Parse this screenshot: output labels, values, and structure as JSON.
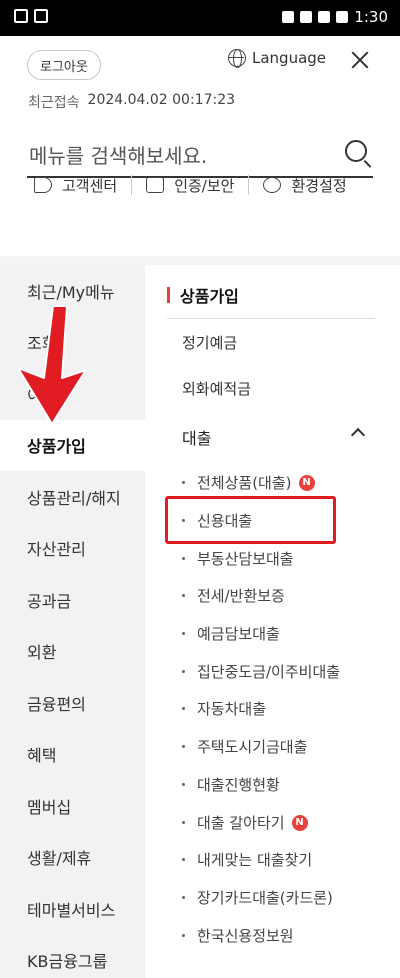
{
  "status_bar": {
    "time": "1:30"
  },
  "header": {
    "logout_label": "로그아웃",
    "language_label": "Language",
    "last_access_label": "최근접속",
    "last_access_value": "2024.04.02 00:17:23"
  },
  "search": {
    "placeholder": "메뉴를 검색해보세요."
  },
  "quick_links": [
    {
      "label": "고객센터",
      "icon": "speaker-icon"
    },
    {
      "label": "인증/보안",
      "icon": "lock-icon"
    },
    {
      "label": "환경설정",
      "icon": "gear-icon"
    }
  ],
  "left_nav": {
    "items": [
      {
        "label": "최근/My메뉴"
      },
      {
        "label": "조회"
      },
      {
        "label": "이체"
      },
      {
        "label": "상품가입",
        "active": true
      },
      {
        "label": "상품관리/해지"
      },
      {
        "label": "자산관리"
      },
      {
        "label": "공과금"
      },
      {
        "label": "외환"
      },
      {
        "label": "금융편의"
      },
      {
        "label": "혜택"
      },
      {
        "label": "멤버십"
      },
      {
        "label": "생활/제휴"
      },
      {
        "label": "테마별서비스"
      },
      {
        "label": "KB금융그룹"
      }
    ]
  },
  "right_panel": {
    "section_title": "상품가입",
    "items": [
      {
        "label": "정기예금"
      },
      {
        "label": "외화예적금"
      }
    ],
    "loan_group": {
      "title": "대출",
      "items": [
        {
          "label": "전체상품(대출)",
          "badge": "N"
        },
        {
          "label": "신용대출",
          "highlighted": true
        },
        {
          "label": "부동산담보대출"
        },
        {
          "label": "전세/반환보증"
        },
        {
          "label": "예금담보대출"
        },
        {
          "label": "집단중도금/이주비대출"
        },
        {
          "label": "자동차대출"
        },
        {
          "label": "주택도시기금대출"
        },
        {
          "label": "대출진행현황"
        },
        {
          "label": "대출 갈아타기",
          "badge": "N"
        },
        {
          "label": "내게맞는 대출찾기"
        },
        {
          "label": "장기카드대출(카드론)"
        },
        {
          "label": "한국신용정보원"
        }
      ]
    }
  },
  "colors": {
    "accent": "#e8413b",
    "highlight_border": "#e11b22"
  }
}
